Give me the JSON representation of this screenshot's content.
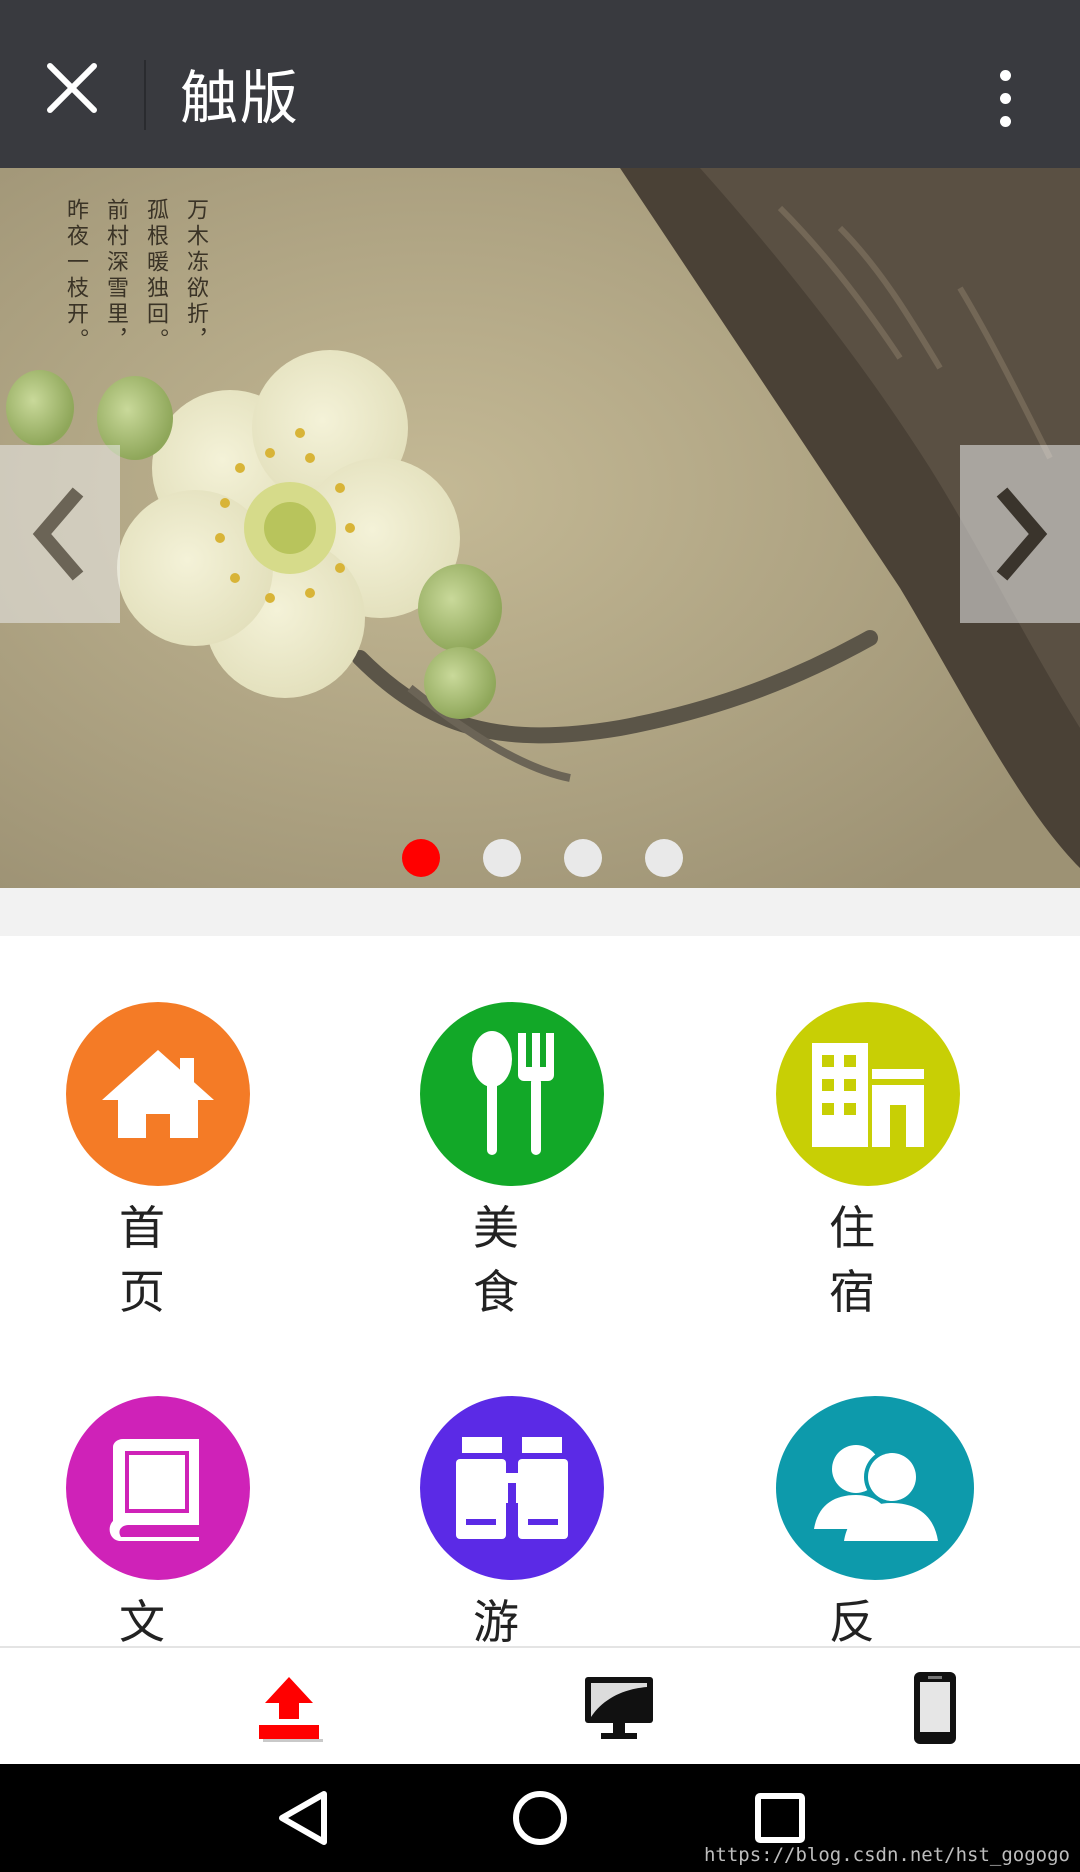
{
  "title_bar": {
    "title": "触版",
    "close_icon": "close-icon",
    "more_icon": "more-vertical-icon"
  },
  "carousel": {
    "poem_lines": [
      "万木冻欲折，",
      "孤根暖独回。",
      "前村深雪里，",
      "昨夜一枝开。"
    ],
    "prev_icon": "chevron-left-icon",
    "next_icon": "chevron-right-icon",
    "slide_count": 4,
    "active_slide": 1,
    "active_color": "#ff0000",
    "inactive_color": "#e9e9e9"
  },
  "grid": {
    "items": [
      {
        "label": "首页",
        "icon": "home-icon",
        "color": "#f47b26"
      },
      {
        "label": "美食",
        "icon": "utensils-icon",
        "color": "#12a828"
      },
      {
        "label": "住宿",
        "icon": "building-icon",
        "color": "#c8cf05"
      },
      {
        "label": "文",
        "icon": "book-icon",
        "color": "#cf22b8"
      },
      {
        "label": "游",
        "icon": "binoculars-icon",
        "color": "#5b2ae6"
      },
      {
        "label": "反",
        "icon": "users-icon",
        "color": "#0d9aab"
      }
    ]
  },
  "toolbar": {
    "items": [
      {
        "icon": "upload-icon",
        "color": "#ff0000"
      },
      {
        "icon": "desktop-icon",
        "color": "#000000"
      },
      {
        "icon": "mobile-icon",
        "color": "#000000"
      }
    ]
  },
  "navbar": {
    "back_icon": "nav-back-icon",
    "home_icon": "nav-home-icon",
    "recents_icon": "nav-recents-icon"
  },
  "watermark": "https://blog.csdn.net/hst_gogogo"
}
